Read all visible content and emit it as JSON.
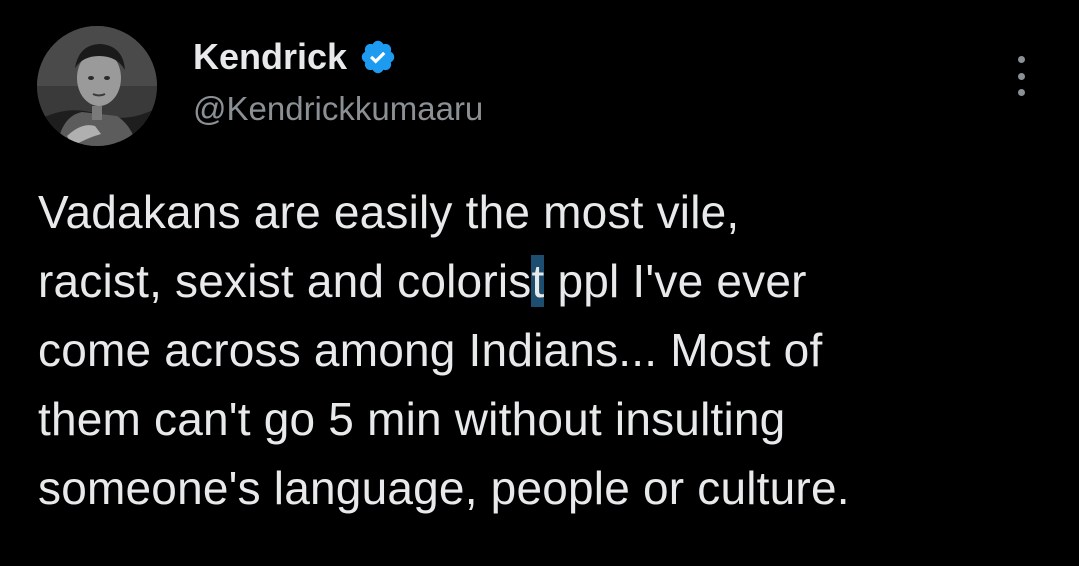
{
  "author": {
    "display_name": "Kendrick",
    "handle": "@Kendrickkumaaru",
    "verified": true,
    "verified_icon": "verified-badge-icon",
    "avatar_icon": "profile-photo-avatar"
  },
  "tweet": {
    "lines": [
      {
        "text": "Vadakans are easily the most vile,"
      },
      {
        "before": "racist, sexist and coloris",
        "selected": "t",
        "after": " ppl I've ever"
      },
      {
        "text": "come across among Indians... Most of"
      },
      {
        "text": "them can't go 5 min without insulting"
      },
      {
        "text": "someone's language, people or culture."
      }
    ]
  },
  "menu": {
    "icon": "more-options-icon"
  },
  "colors": {
    "background": "#000000",
    "text": "#e7e9ea",
    "secondary_text": "#8b9095",
    "verified": "#1d9bf0",
    "selection": "#1d4e6f"
  }
}
